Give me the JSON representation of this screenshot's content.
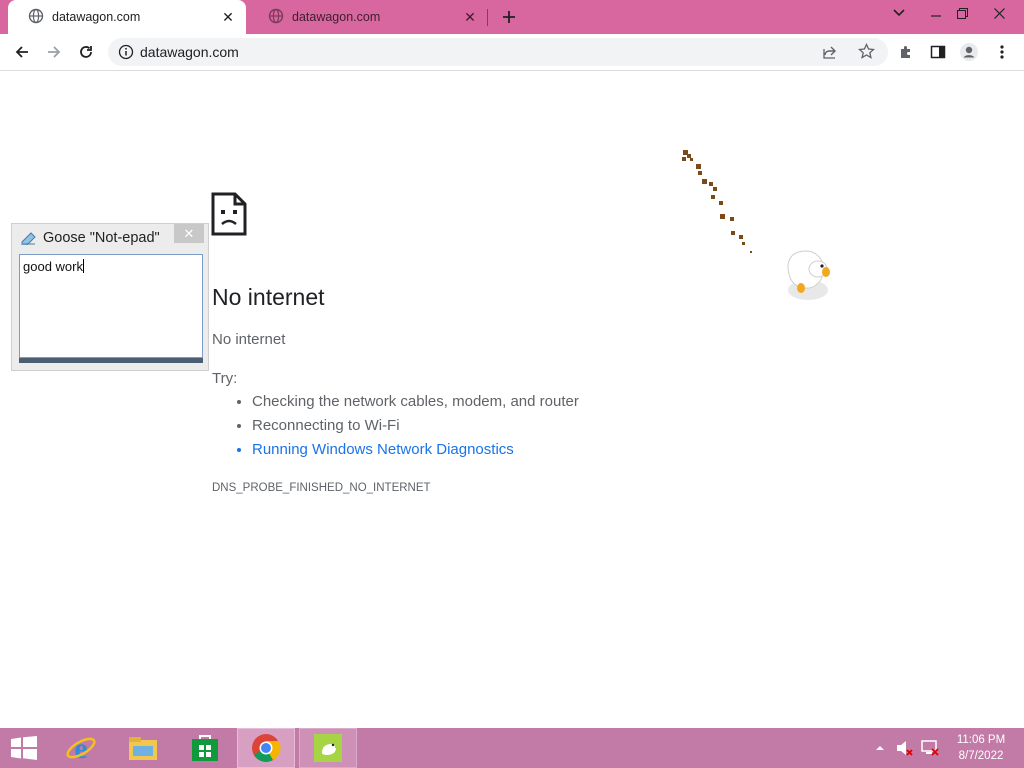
{
  "browser": {
    "tabs": [
      {
        "title": "datawagon.com",
        "icon": "globe-icon",
        "active": true
      },
      {
        "title": "datawagon.com",
        "icon": "globe-icon",
        "active": false
      }
    ],
    "url": "datawagon.com",
    "accent_color": "#d9679f"
  },
  "error_page": {
    "title": "No internet",
    "subtitle": "No internet",
    "try_label": "Try:",
    "suggestions": [
      "Checking the network cables, modem, and router",
      "Reconnecting to Wi-Fi",
      "Running Windows Network Diagnostics"
    ],
    "error_code": "DNS_PROBE_FINISHED_NO_INTERNET",
    "link_color": "#1a73e8"
  },
  "notepad": {
    "title": "Goose \"Not-epad\"",
    "text": "good work",
    "close_glyph": "✕"
  },
  "taskbar": {
    "apps": [
      "start-icon",
      "internet-explorer-icon",
      "file-explorer-icon",
      "store-icon",
      "chrome-icon",
      "goose-app-icon"
    ],
    "time": "11:06 PM",
    "date": "8/7/2022"
  }
}
